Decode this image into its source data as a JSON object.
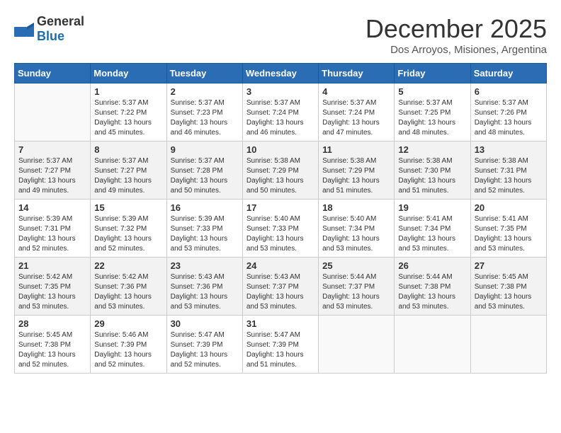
{
  "header": {
    "logo": {
      "general": "General",
      "blue": "Blue"
    },
    "month_title": "December 2025",
    "subtitle": "Dos Arroyos, Misiones, Argentina"
  },
  "calendar": {
    "days_of_week": [
      "Sunday",
      "Monday",
      "Tuesday",
      "Wednesday",
      "Thursday",
      "Friday",
      "Saturday"
    ],
    "weeks": [
      [
        {
          "day": "",
          "info": ""
        },
        {
          "day": "1",
          "info": "Sunrise: 5:37 AM\nSunset: 7:22 PM\nDaylight: 13 hours\nand 45 minutes."
        },
        {
          "day": "2",
          "info": "Sunrise: 5:37 AM\nSunset: 7:23 PM\nDaylight: 13 hours\nand 46 minutes."
        },
        {
          "day": "3",
          "info": "Sunrise: 5:37 AM\nSunset: 7:24 PM\nDaylight: 13 hours\nand 46 minutes."
        },
        {
          "day": "4",
          "info": "Sunrise: 5:37 AM\nSunset: 7:24 PM\nDaylight: 13 hours\nand 47 minutes."
        },
        {
          "day": "5",
          "info": "Sunrise: 5:37 AM\nSunset: 7:25 PM\nDaylight: 13 hours\nand 48 minutes."
        },
        {
          "day": "6",
          "info": "Sunrise: 5:37 AM\nSunset: 7:26 PM\nDaylight: 13 hours\nand 48 minutes."
        }
      ],
      [
        {
          "day": "7",
          "info": "Sunrise: 5:37 AM\nSunset: 7:27 PM\nDaylight: 13 hours\nand 49 minutes."
        },
        {
          "day": "8",
          "info": "Sunrise: 5:37 AM\nSunset: 7:27 PM\nDaylight: 13 hours\nand 49 minutes."
        },
        {
          "day": "9",
          "info": "Sunrise: 5:37 AM\nSunset: 7:28 PM\nDaylight: 13 hours\nand 50 minutes."
        },
        {
          "day": "10",
          "info": "Sunrise: 5:38 AM\nSunset: 7:29 PM\nDaylight: 13 hours\nand 50 minutes."
        },
        {
          "day": "11",
          "info": "Sunrise: 5:38 AM\nSunset: 7:29 PM\nDaylight: 13 hours\nand 51 minutes."
        },
        {
          "day": "12",
          "info": "Sunrise: 5:38 AM\nSunset: 7:30 PM\nDaylight: 13 hours\nand 51 minutes."
        },
        {
          "day": "13",
          "info": "Sunrise: 5:38 AM\nSunset: 7:31 PM\nDaylight: 13 hours\nand 52 minutes."
        }
      ],
      [
        {
          "day": "14",
          "info": "Sunrise: 5:39 AM\nSunset: 7:31 PM\nDaylight: 13 hours\nand 52 minutes."
        },
        {
          "day": "15",
          "info": "Sunrise: 5:39 AM\nSunset: 7:32 PM\nDaylight: 13 hours\nand 52 minutes."
        },
        {
          "day": "16",
          "info": "Sunrise: 5:39 AM\nSunset: 7:33 PM\nDaylight: 13 hours\nand 53 minutes."
        },
        {
          "day": "17",
          "info": "Sunrise: 5:40 AM\nSunset: 7:33 PM\nDaylight: 13 hours\nand 53 minutes."
        },
        {
          "day": "18",
          "info": "Sunrise: 5:40 AM\nSunset: 7:34 PM\nDaylight: 13 hours\nand 53 minutes."
        },
        {
          "day": "19",
          "info": "Sunrise: 5:41 AM\nSunset: 7:34 PM\nDaylight: 13 hours\nand 53 minutes."
        },
        {
          "day": "20",
          "info": "Sunrise: 5:41 AM\nSunset: 7:35 PM\nDaylight: 13 hours\nand 53 minutes."
        }
      ],
      [
        {
          "day": "21",
          "info": "Sunrise: 5:42 AM\nSunset: 7:35 PM\nDaylight: 13 hours\nand 53 minutes."
        },
        {
          "day": "22",
          "info": "Sunrise: 5:42 AM\nSunset: 7:36 PM\nDaylight: 13 hours\nand 53 minutes."
        },
        {
          "day": "23",
          "info": "Sunrise: 5:43 AM\nSunset: 7:36 PM\nDaylight: 13 hours\nand 53 minutes."
        },
        {
          "day": "24",
          "info": "Sunrise: 5:43 AM\nSunset: 7:37 PM\nDaylight: 13 hours\nand 53 minutes."
        },
        {
          "day": "25",
          "info": "Sunrise: 5:44 AM\nSunset: 7:37 PM\nDaylight: 13 hours\nand 53 minutes."
        },
        {
          "day": "26",
          "info": "Sunrise: 5:44 AM\nSunset: 7:38 PM\nDaylight: 13 hours\nand 53 minutes."
        },
        {
          "day": "27",
          "info": "Sunrise: 5:45 AM\nSunset: 7:38 PM\nDaylight: 13 hours\nand 53 minutes."
        }
      ],
      [
        {
          "day": "28",
          "info": "Sunrise: 5:45 AM\nSunset: 7:38 PM\nDaylight: 13 hours\nand 52 minutes."
        },
        {
          "day": "29",
          "info": "Sunrise: 5:46 AM\nSunset: 7:39 PM\nDaylight: 13 hours\nand 52 minutes."
        },
        {
          "day": "30",
          "info": "Sunrise: 5:47 AM\nSunset: 7:39 PM\nDaylight: 13 hours\nand 52 minutes."
        },
        {
          "day": "31",
          "info": "Sunrise: 5:47 AM\nSunset: 7:39 PM\nDaylight: 13 hours\nand 51 minutes."
        },
        {
          "day": "",
          "info": ""
        },
        {
          "day": "",
          "info": ""
        },
        {
          "day": "",
          "info": ""
        }
      ]
    ]
  }
}
